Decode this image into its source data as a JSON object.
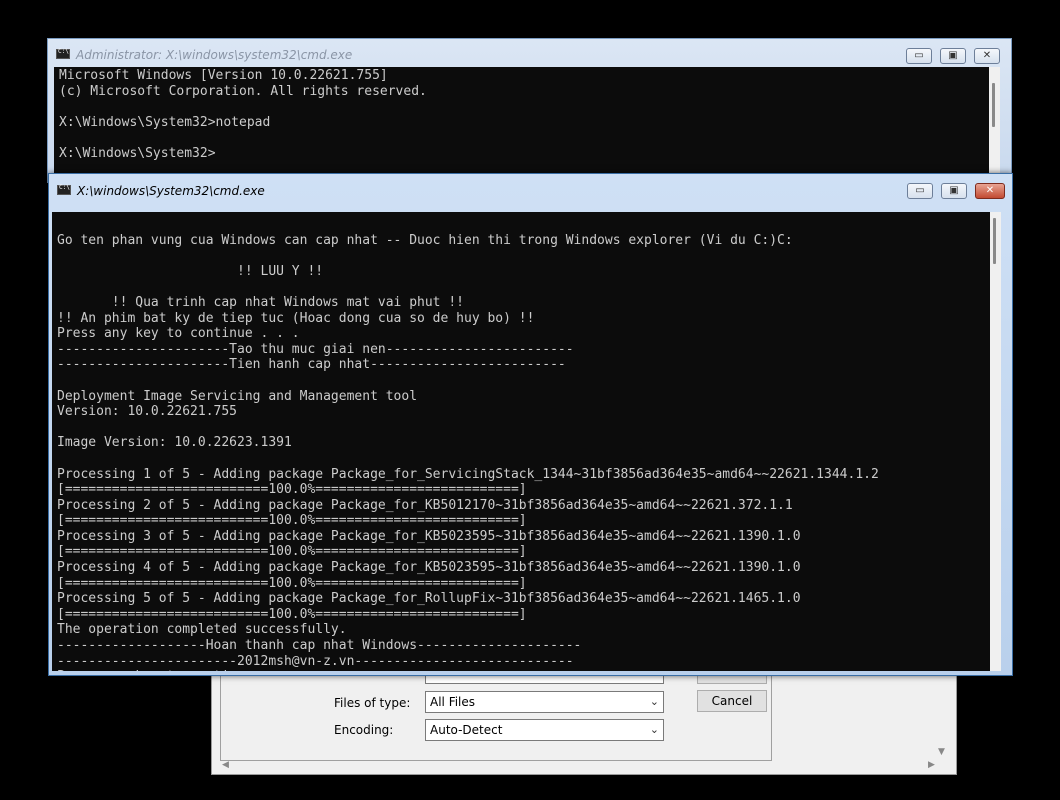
{
  "back_window": {
    "title": "Administrator: X:\\windows\\system32\\cmd.exe",
    "lines": [
      "Microsoft Windows [Version 10.0.22621.755]",
      "(c) Microsoft Corporation. All rights reserved.",
      "",
      "X:\\Windows\\System32>notepad",
      "",
      "X:\\Windows\\System32>"
    ]
  },
  "front_window": {
    "title": "X:\\windows\\System32\\cmd.exe",
    "lines": [
      "",
      "Go ten phan vung cua Windows can cap nhat -- Duoc hien thi trong Windows explorer (Vi du C:)C:",
      "",
      "                       !! LUU Y !!",
      "",
      "       !! Qua trinh cap nhat Windows mat vai phut !!",
      "!! An phim bat ky de tiep tuc (Hoac dong cua so de huy bo) !!",
      "Press any key to continue . . .",
      "----------------------Tao thu muc giai nen------------------------",
      "----------------------Tien hanh cap nhat-------------------------",
      "",
      "Deployment Image Servicing and Management tool",
      "Version: 10.0.22621.755",
      "",
      "Image Version: 10.0.22623.1391",
      "",
      "Processing 1 of 5 - Adding package Package_for_ServicingStack_1344~31bf3856ad364e35~amd64~~22621.1344.1.2",
      "[==========================100.0%==========================]",
      "Processing 2 of 5 - Adding package Package_for_KB5012170~31bf3856ad364e35~amd64~~22621.372.1.1",
      "[==========================100.0%==========================]",
      "Processing 3 of 5 - Adding package Package_for_KB5023595~31bf3856ad364e35~amd64~~22621.1390.1.0",
      "[==========================100.0%==========================]",
      "Processing 4 of 5 - Adding package Package_for_KB5023595~31bf3856ad364e35~amd64~~22621.1390.1.0",
      "[==========================100.0%==========================]",
      "Processing 5 of 5 - Adding package Package_for_RollupFix~31bf3856ad364e35~amd64~~22621.1465.1.0",
      "[==========================100.0%==========================]",
      "The operation completed successfully.",
      "-------------------Hoan thanh cap nhat Windows---------------------",
      "-----------------------2012msh@vn-z.vn----------------------------",
      "Press any key to continue . . . "
    ]
  },
  "window_controls": {
    "minimize": "▭",
    "maximize": "▣",
    "close": "✕"
  },
  "dialog": {
    "files_of_type_label": "Files of type:",
    "files_of_type_value": "All Files",
    "encoding_label": "Encoding:",
    "encoding_value": "Auto-Detect",
    "cancel_label": "Cancel",
    "chevron": "⌄"
  }
}
